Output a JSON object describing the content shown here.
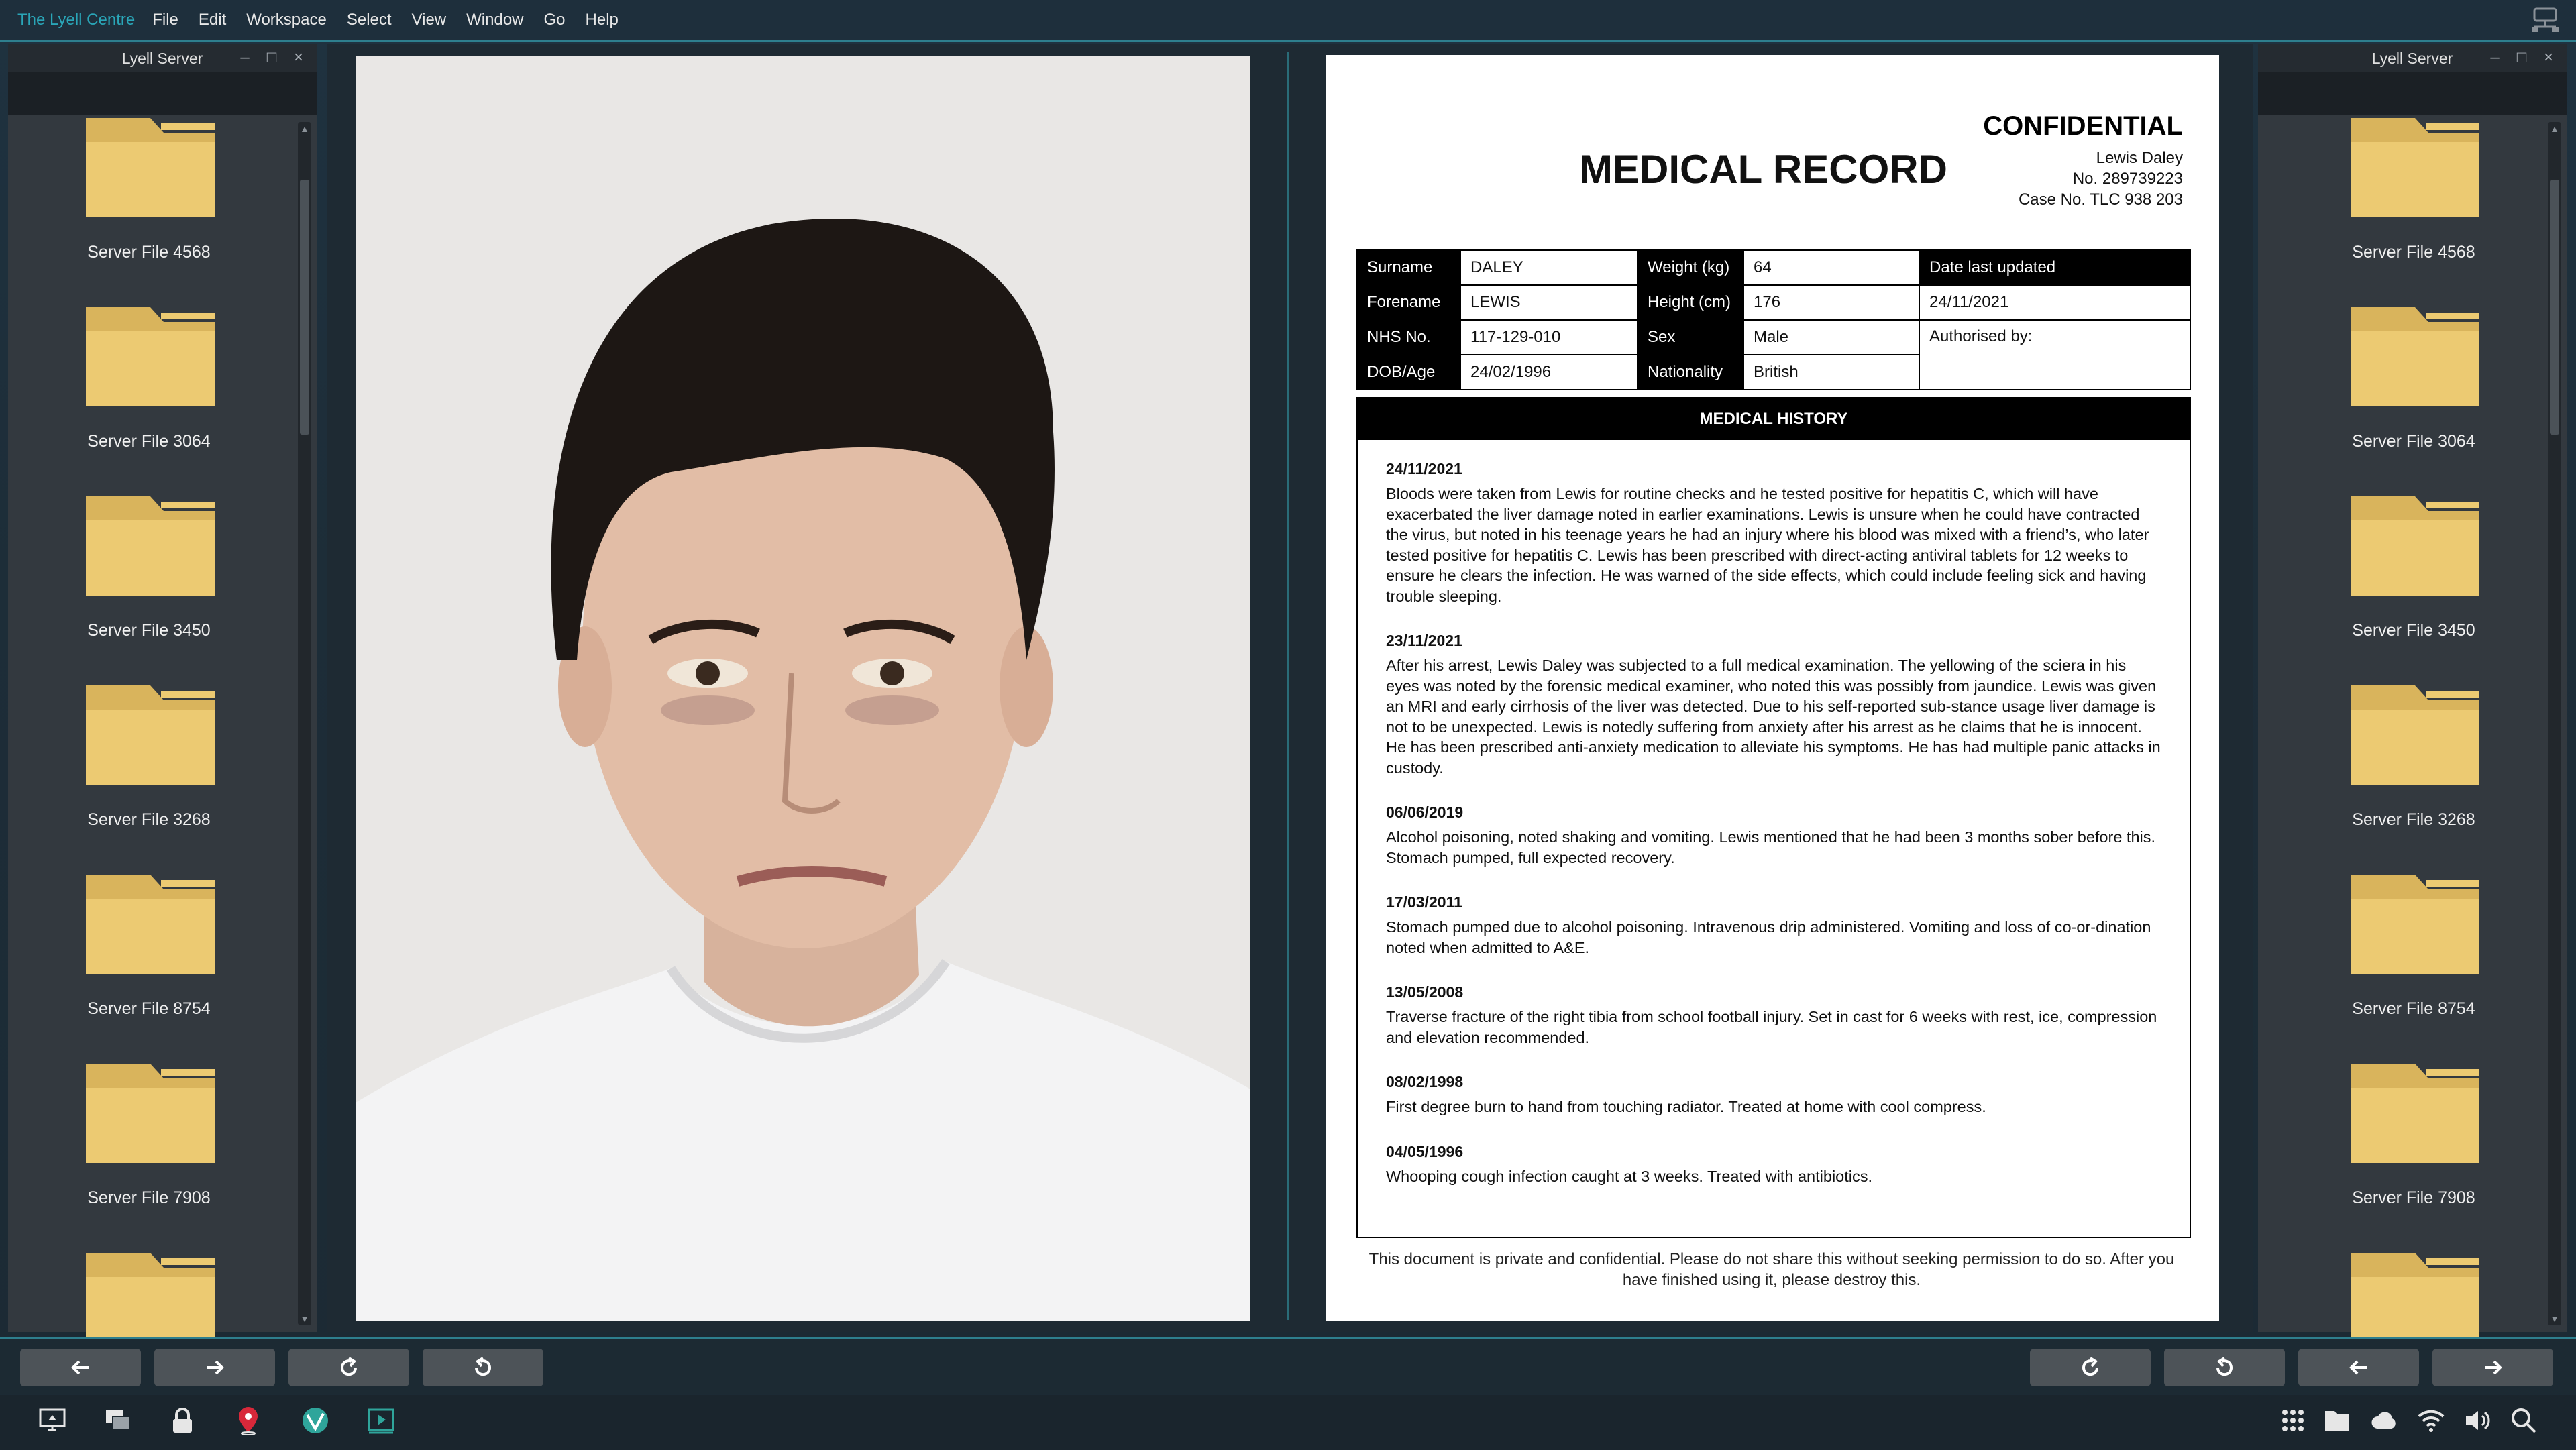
{
  "menubar": {
    "app_name": "The Lyell Centre",
    "items": [
      "File",
      "Edit",
      "Workspace",
      "Select",
      "View",
      "Window",
      "Go",
      "Help"
    ]
  },
  "left_window": {
    "title": "Lyell Server",
    "files": [
      "Server File 4568",
      "Server File 3064",
      "Server File 3450",
      "Server File 3268",
      "Server File 8754",
      "Server File 7908"
    ]
  },
  "right_window": {
    "title": "Lyell Server",
    "files": [
      "Server File 4568",
      "Server File 3064",
      "Server File 3450",
      "Server File 3268",
      "Server File 8754",
      "Server File 7908"
    ]
  },
  "document": {
    "confidential": "CONFIDENTIAL",
    "title": "MEDICAL RECORD",
    "meta": {
      "name": "Lewis Daley",
      "number": "No. 289739223",
      "case": "Case No. TLC 938 203"
    },
    "fields": {
      "surname_label": "Surname",
      "surname": "DALEY",
      "forename_label": "Forename",
      "forename": "LEWIS",
      "nhs_label": "NHS No.",
      "nhs": "117-129-010",
      "dob_label": "DOB/Age",
      "dob": "24/02/1996",
      "weight_label": "Weight (kg)",
      "weight": "64",
      "height_label": "Height (cm)",
      "height": "176",
      "sex_label": "Sex",
      "sex": "Male",
      "nationality_label": "Nationality",
      "nationality": "British",
      "date_updated_label": "Date last updated",
      "date_updated": "24/11/2021",
      "authorised_label": "Authorised by:"
    },
    "history_title": "MEDICAL HISTORY",
    "history": [
      {
        "date": "24/11/2021",
        "text": "Bloods were taken from Lewis for routine checks and he tested positive for hepatitis C, which will have exacerbated the liver damage noted in earlier examinations. Lewis is unsure when he could have contracted the virus, but noted in his teenage years he had an injury where his blood was mixed with a friend’s, who later tested positive for hepatitis C. Lewis has been prescribed with direct-acting antiviral tablets for 12 weeks to ensure he clears the infection. He was warned of the side effects, which could include feeling sick and having trouble sleeping."
      },
      {
        "date": "23/11/2021",
        "text": "After his arrest, Lewis Daley was subjected to a full medical examination. The yellowing of the sciera in his eyes was noted by the forensic medical examiner, who noted this was possibly from jaundice. Lewis was given an MRI and early cirrhosis of the liver was detected. Due to his self-reported sub-stance usage liver damage is not to be unexpected. Lewis is notedly suffering from anxiety after his arrest as he claims that he is innocent. He has been prescribed anti-anxiety medication to alleviate his symptoms. He has had multiple panic attacks in custody."
      },
      {
        "date": "06/06/2019",
        "text": "Alcohol poisoning, noted shaking and vomiting. Lewis mentioned that he had been 3 months sober before this. Stomach pumped, full expected recovery."
      },
      {
        "date": "17/03/2011",
        "text": "Stomach pumped due to alcohol poisoning. Intravenous drip administered. Vomiting and loss of co-or-dination noted when admitted to A&E."
      },
      {
        "date": "13/05/2008",
        "text": "Traverse fracture of the right tibia from school football injury. Set in cast for 6 weeks with rest, ice, compression and elevation recommended."
      },
      {
        "date": "08/02/1998",
        "text": "First degree burn to hand from touching radiator. Treated at home with cool compress."
      },
      {
        "date": "04/05/1996",
        "text": "Whooping cough infection caught at 3 weeks. Treated with antibiotics."
      }
    ],
    "footer": "This document is private and confidential. Please do not share this without seeking permission to do so. After you have finished using it, please destroy this."
  },
  "colors": {
    "accent": "#2aa6b8",
    "folder": "#e6c46a",
    "button": "#4d5358"
  },
  "icons": {
    "nav_left": [
      "arrow-left-icon",
      "arrow-right-icon",
      "redo-icon",
      "undo-icon"
    ],
    "nav_right": [
      "redo-icon",
      "undo-icon",
      "arrow-left-icon",
      "arrow-right-icon"
    ],
    "taskbar_left": [
      "display-icon",
      "windows-icon",
      "lock-icon",
      "location-pin-icon",
      "globe-icon",
      "media-player-icon"
    ],
    "taskbar_right": [
      "apps-grid-icon",
      "folder-icon",
      "cloud-icon",
      "wifi-icon",
      "volume-icon",
      "search-icon"
    ]
  }
}
